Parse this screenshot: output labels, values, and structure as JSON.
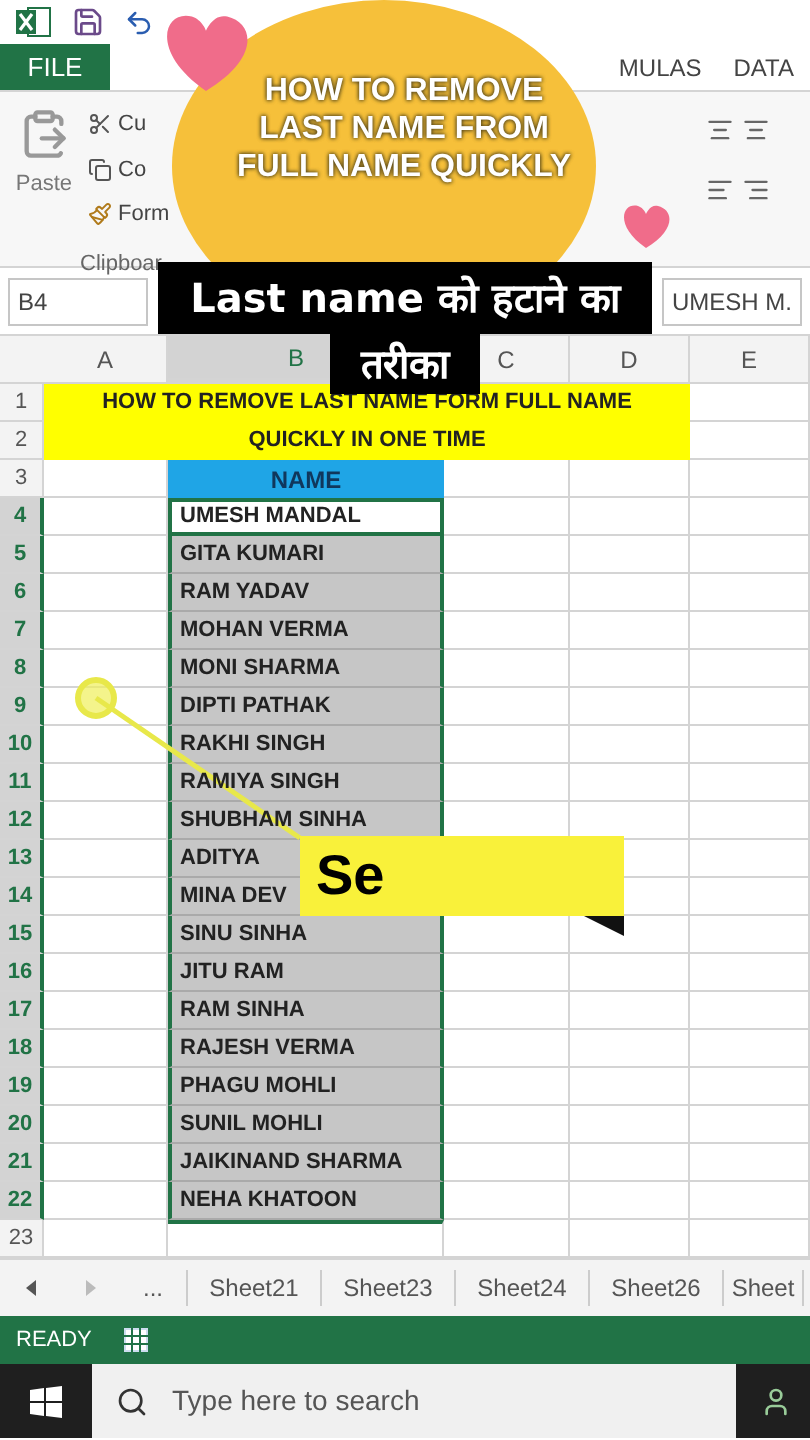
{
  "ribbon": {
    "tabs": [
      {
        "label": "FILE",
        "kind": "file"
      },
      {
        "label": "MULAS",
        "kind": "tab"
      },
      {
        "label": "DATA",
        "kind": "tab"
      }
    ],
    "paste": "Paste",
    "clipboard_items": [
      "Cu",
      "Co",
      "Form"
    ],
    "group": "Clipboar"
  },
  "formula_bar": {
    "name_box": "B4",
    "value": "UMESH M."
  },
  "sheet": {
    "columns": [
      "A",
      "B",
      "C",
      "D",
      "E"
    ],
    "title": "HOW TO REMOVE LAST NAME FORM FULL NAME QUICKLY IN ONE TIME",
    "title_rows": [
      "1",
      "2"
    ],
    "header_row": "3",
    "header": "NAME",
    "last_row": "23",
    "rows": [
      {
        "number": "4",
        "name": "UMESH MANDAL",
        "selected": true,
        "active": true
      },
      {
        "number": "5",
        "name": "GITA KUMARI",
        "selected": true,
        "active": false
      },
      {
        "number": "6",
        "name": "RAM YADAV",
        "selected": true,
        "active": false
      },
      {
        "number": "7",
        "name": "MOHAN VERMA",
        "selected": true,
        "active": false
      },
      {
        "number": "8",
        "name": "MONI SHARMA",
        "selected": true,
        "active": false
      },
      {
        "number": "9",
        "name": "DIPTI PATHAK",
        "selected": true,
        "active": false
      },
      {
        "number": "10",
        "name": "RAKHI SINGH",
        "selected": true,
        "active": false
      },
      {
        "number": "11",
        "name": "RAMIYA SINGH",
        "selected": true,
        "active": false
      },
      {
        "number": "12",
        "name": "SHUBHAM SINHA",
        "selected": true,
        "active": false
      },
      {
        "number": "13",
        "name": "ADITYA",
        "selected": true,
        "active": false
      },
      {
        "number": "14",
        "name": "MINA DEV",
        "selected": true,
        "active": false
      },
      {
        "number": "15",
        "name": "SINU SINHA",
        "selected": true,
        "active": false
      },
      {
        "number": "16",
        "name": "JITU RAM",
        "selected": true,
        "active": false
      },
      {
        "number": "17",
        "name": "RAM SINHA",
        "selected": true,
        "active": false
      },
      {
        "number": "18",
        "name": "RAJESH VERMA",
        "selected": true,
        "active": false
      },
      {
        "number": "19",
        "name": "PHAGU MOHLI",
        "selected": true,
        "active": false
      },
      {
        "number": "20",
        "name": "SUNIL MOHLI",
        "selected": true,
        "active": false
      },
      {
        "number": "21",
        "name": "JAIKINAND SHARMA",
        "selected": true,
        "active": false
      },
      {
        "number": "22",
        "name": "NEHA KHATOON",
        "selected": true,
        "active": false
      }
    ]
  },
  "sheet_tabs": [
    "...",
    "Sheet21",
    "Sheet23",
    "Sheet24",
    "Sheet26",
    "Sheet"
  ],
  "status_bar": {
    "text": "READY"
  },
  "taskbar": {
    "search": {
      "placeholder": "Type here to search"
    }
  },
  "overlay": {
    "headline": "HOW TO REMOVE LAST NAME FROM FULL NAME QUICKLY",
    "caption_lines": [
      "Last name को हटाने का",
      "तरीका"
    ],
    "callout": "Se"
  }
}
